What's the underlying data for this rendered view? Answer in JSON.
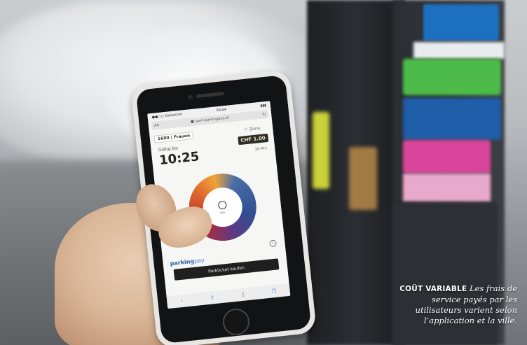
{
  "phone": {
    "status_carrier": "●●○○ Swisscom",
    "status_time": "09:44",
    "status_battery": "▮▮▮",
    "url_aa": "AA",
    "url": "■ sunrl.parkingpay.ch",
    "url_reload": "↻",
    "plate": "1600 | Frauen",
    "zone": "⚐ Zone",
    "valid_label": "Gültig bis",
    "valid_time": "10:25",
    "price": "CHF 1.00",
    "duration": "26 Min.",
    "dial_caption": "Min.",
    "info_glyph": "i",
    "brand_part1": "parking",
    "brand_part2": "pay",
    "buy_label": "Parkticket kaufen",
    "toolbar_icons": [
      "‹",
      "⇪",
      "▯",
      "❐"
    ]
  },
  "caption": {
    "heading": "COÛT VARIABLE",
    "text": "Les frais de service payés par les utilisateurs varient selon l’application et la ville."
  }
}
